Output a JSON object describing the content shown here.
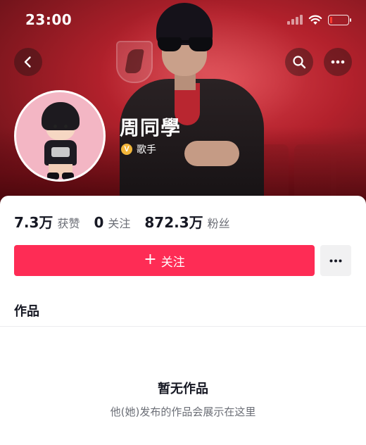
{
  "status_bar": {
    "time": "23:00",
    "signal_icon": "signal-bars-icon",
    "wifi_icon": "wifi-icon",
    "battery_icon": "battery-low-icon",
    "battery_level": 0.12,
    "battery_color": "#ff3b30"
  },
  "header": {
    "back_icon": "chevron-left-icon",
    "search_icon": "search-icon",
    "more_icon": "more-dots-icon"
  },
  "profile": {
    "name": "周同學",
    "verified_badge": "V",
    "verified_label": "歌手"
  },
  "stats": [
    {
      "value": "7.3万",
      "label": "获赞"
    },
    {
      "value": "0",
      "label": "关注"
    },
    {
      "value": "872.3万",
      "label": "粉丝"
    }
  ],
  "actions": {
    "follow_plus": "+",
    "follow_label": "关注",
    "more_icon": "more-dots-icon"
  },
  "tabs": {
    "works_label": "作品"
  },
  "empty_state": {
    "title": "暂无作品",
    "subtitle": "他(她)发布的作品会展示在这里"
  },
  "colors": {
    "accent": "#fe2c55",
    "cover": "#b3212c",
    "badge": "#f2b63a"
  }
}
